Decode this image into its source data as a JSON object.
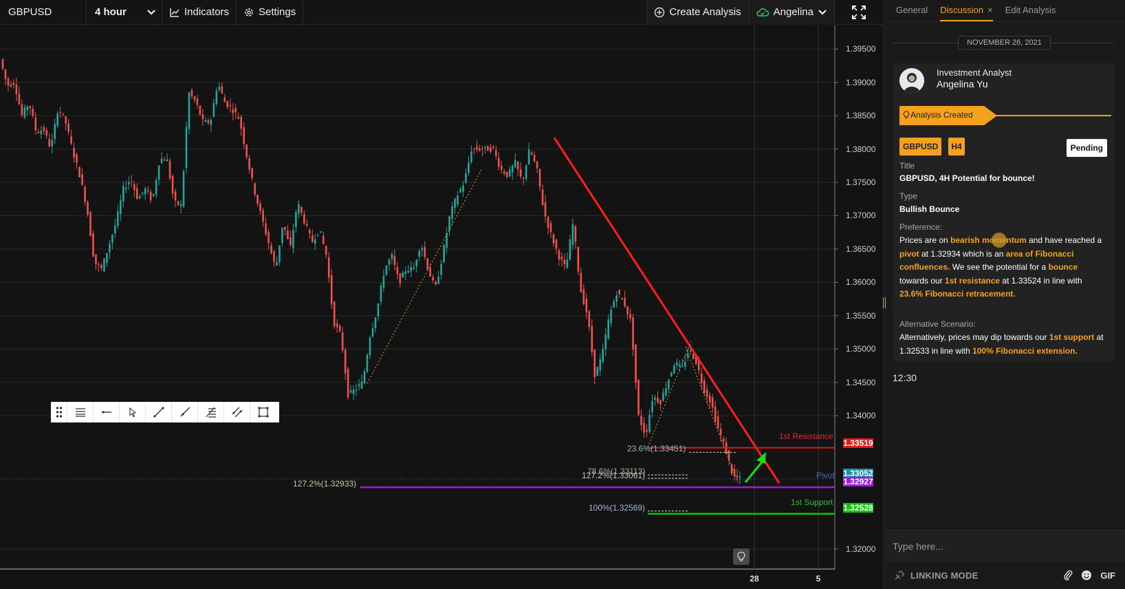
{
  "toolbar": {
    "symbol": "GBPUSD",
    "interval": "4 hour",
    "indicators_label": "Indicators",
    "settings_label": "Settings",
    "create_label": "Create Analysis",
    "user_label": "Angelina"
  },
  "chart_data": {
    "type": "candlestick",
    "symbol": "GBPUSD",
    "timeframe": "4 hour",
    "y_ticks": [
      "1.39500",
      "1.39000",
      "1.38500",
      "1.38000",
      "1.37500",
      "1.37000",
      "1.36500",
      "1.36000",
      "1.35500",
      "1.35000",
      "1.34500",
      "1.34000",
      "1.32000"
    ],
    "ylim": [
      1.317,
      1.3975
    ],
    "x_ticks": [
      "28",
      "5"
    ],
    "price_path": [
      1.3935,
      1.3895,
      1.39,
      1.385,
      1.387,
      1.3825,
      1.383,
      1.38,
      1.3862,
      1.3842,
      1.3798,
      1.376,
      1.371,
      1.363,
      1.362,
      1.3655,
      1.369,
      1.374,
      1.3755,
      1.3725,
      1.374,
      1.3722,
      1.3785,
      1.3785,
      1.372,
      1.3715,
      1.3885,
      1.387,
      1.384,
      1.384,
      1.39,
      1.387,
      1.386,
      1.3845,
      1.379,
      1.374,
      1.37,
      1.366,
      1.362,
      1.369,
      1.365,
      1.372,
      1.369,
      1.366,
      1.368,
      1.364,
      1.354,
      1.352,
      1.343,
      1.344,
      1.345,
      1.352,
      1.356,
      1.362,
      1.364,
      1.36,
      1.362,
      1.362,
      1.366,
      1.362,
      1.359,
      1.364,
      1.37,
      1.373,
      1.375,
      1.38,
      1.38,
      1.38,
      1.38,
      1.377,
      1.376,
      1.378,
      1.375,
      1.38,
      1.377,
      1.3705,
      1.367,
      1.364,
      1.362,
      1.369,
      1.359,
      1.355,
      1.346,
      1.349,
      1.355,
      1.3585,
      1.357,
      1.354,
      1.34,
      1.337,
      1.343,
      1.342,
      1.345,
      1.348,
      1.347,
      1.35,
      1.348,
      1.344,
      1.342,
      1.338,
      1.335,
      1.331,
      1.3305
    ],
    "annotations": {
      "trendline": {
        "from": 1.3817,
        "to": 1.333,
        "color": "#ff1e1e"
      },
      "levels": [
        {
          "name": "1st Resistance",
          "value": 1.33519,
          "color": "#e01b1b"
        },
        {
          "name": "Pivot",
          "value": 1.33052,
          "color": "#2f8fb0"
        },
        {
          "name": "127.2% level",
          "value": 1.32927,
          "color": "#9b1fd6"
        },
        {
          "name": "1st Support",
          "value": 1.32528,
          "color": "#12c212"
        }
      ],
      "fib_labels": [
        {
          "text": "23.6%(1.33451)",
          "value": 1.33451
        },
        {
          "text": "78.6%(1.33113)",
          "value": 1.33113
        },
        {
          "text": "127.2%(1.33061)",
          "value": 1.33061
        },
        {
          "text": "127.2%(1.32933)",
          "value": 1.32933
        },
        {
          "text": "100%(1.32569)",
          "value": 1.32569
        }
      ]
    }
  },
  "chart_labels": {
    "resistance": "1st Resistance",
    "pivot": "Pivot",
    "support": "1st Support",
    "badge_resistance": "1.33519",
    "badge_pivot": "1.33052",
    "badge_fib": "1.32927",
    "badge_support": "1.32528",
    "fib_236": "23.6%(1.33451)",
    "fib_786": "78.6%(1.33113)",
    "fib_1272a": "127.2%(1.33061)",
    "fib_1272b": "127.2%(1.32933)",
    "fib_100": "100%(1.32569)",
    "x_28": "28",
    "x_5": "5"
  },
  "colors": {
    "bull": "#26a69a",
    "bear": "#ef5350",
    "accent": "#f4a21e"
  },
  "icons": [
    "chevron-down-icon",
    "chart-line-icon",
    "gear-icon",
    "plus-circle-icon",
    "cloud-check-icon",
    "fullscreen-icon",
    "drag-handle-icon",
    "lines-icon",
    "horizontal-ray-icon",
    "cursor-icon",
    "trend-line-icon",
    "ray-icon",
    "fib-icon",
    "channel-icon",
    "rectangle-icon",
    "lightbulb-icon",
    "paperclip-icon",
    "emoji-icon",
    "link-icon"
  ],
  "panel": {
    "tabs": {
      "general": "General",
      "discussion": "Discussion",
      "close": "×",
      "edit": "Edit Analysis"
    },
    "date": "NOVEMBER 26, 2021",
    "author_role": "Investment Analyst",
    "author_name": "Angelina Yu",
    "status": "Analysis Created",
    "tag_symbol": "GBPUSD",
    "tag_tf": "H4",
    "pending": "Pending",
    "title_label": "Title",
    "title_value": "GBPUSD, 4H Potential for bounce!",
    "type_label": "Type",
    "type_value": "Bullish Bounce",
    "pref_label": "Preference:",
    "pref": {
      "p1": "Prices are on ",
      "h1": "bearish momentum",
      "p2": " and have reached a ",
      "h2": "pivot",
      "p3": " at 1.32934 which is an ",
      "h3": "area of Fibonacci confluences.",
      "p4": " We see the potential for a ",
      "h4": "bounce",
      "p5": " towards our ",
      "h5": "1st resistance",
      "p6": " at 1.33524 in line with ",
      "h6": "23.6% Fibonacci retracement."
    },
    "alt_label": "Alternative Scenario:",
    "alt": {
      "p1": "Alternatively, prices may dip towards our ",
      "h1": "1st support",
      "p2": " at 1.32533 in line with ",
      "h2": "100% Fibonacci extension."
    },
    "time": "12:30",
    "input_placeholder": "Type here...",
    "linking_mode": "LINKING MODE",
    "gif_label": "GIF"
  }
}
